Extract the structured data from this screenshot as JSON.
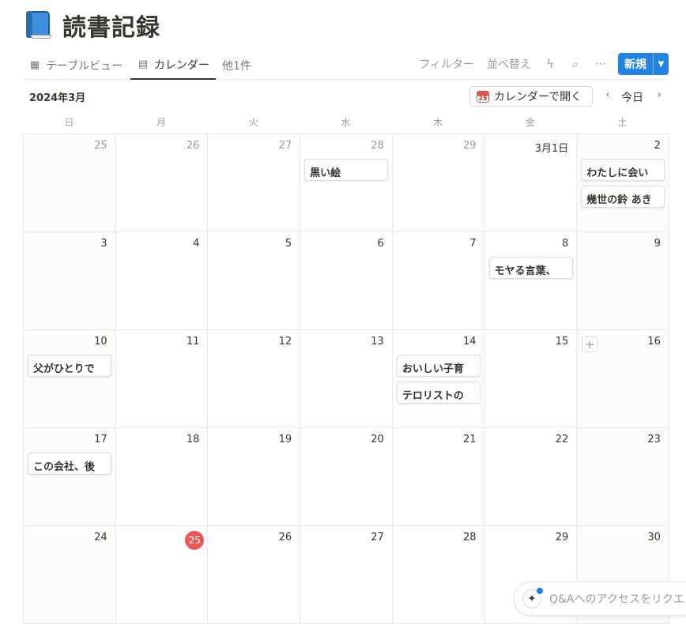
{
  "page": {
    "title": "読書記録"
  },
  "views": {
    "tabs": [
      {
        "label": "テーブルビュー",
        "icon": "table-icon"
      },
      {
        "label": "カレンダー",
        "icon": "calendar-icon",
        "active": true
      },
      {
        "label": "他1件"
      }
    ]
  },
  "toolbar": {
    "filter": "フィルター",
    "sort": "並べ替え",
    "new_label": "新規",
    "icons": [
      "lightning-icon",
      "search-icon",
      "more-icon",
      "chevron-down-icon"
    ]
  },
  "calendar": {
    "month_label": "2024年3月",
    "open_button": "カレンダーで開く",
    "open_icon_num": "25",
    "today_label": "今日",
    "weekdays": [
      "日",
      "月",
      "火",
      "水",
      "木",
      "金",
      "土"
    ],
    "weeks": [
      [
        {
          "label": "25",
          "muted": true
        },
        {
          "label": "26",
          "muted": true
        },
        {
          "label": "27",
          "muted": true
        },
        {
          "label": "28",
          "muted": true,
          "events": [
            "黒い絵"
          ]
        },
        {
          "label": "29",
          "muted": true
        },
        {
          "label": "3月1日"
        },
        {
          "label": "2",
          "events": [
            "わたしに会い",
            "幾世の鈴 あき"
          ]
        }
      ],
      [
        {
          "label": "3"
        },
        {
          "label": "4"
        },
        {
          "label": "5"
        },
        {
          "label": "6"
        },
        {
          "label": "7"
        },
        {
          "label": "8",
          "events": [
            "モヤる言葉、"
          ]
        },
        {
          "label": "9"
        }
      ],
      [
        {
          "label": "10",
          "events": [
            "父がひとりで"
          ]
        },
        {
          "label": "11"
        },
        {
          "label": "12"
        },
        {
          "label": "13"
        },
        {
          "label": "14",
          "events": [
            "おいしい子育",
            "テロリストの"
          ]
        },
        {
          "label": "15"
        },
        {
          "label": "16",
          "plus": true
        }
      ],
      [
        {
          "label": "17",
          "events": [
            "この会社、後"
          ]
        },
        {
          "label": "18"
        },
        {
          "label": "19"
        },
        {
          "label": "20"
        },
        {
          "label": "21"
        },
        {
          "label": "22"
        },
        {
          "label": "23"
        }
      ],
      [
        {
          "label": "24"
        },
        {
          "label": "25",
          "today": true
        },
        {
          "label": "26"
        },
        {
          "label": "27"
        },
        {
          "label": "28"
        },
        {
          "label": "29"
        },
        {
          "label": "30"
        }
      ]
    ]
  },
  "qa": {
    "text": "Q&Aへのアクセスをリクエスト"
  },
  "colors": {
    "accent": "#2383e2",
    "today": "#eb5757"
  }
}
